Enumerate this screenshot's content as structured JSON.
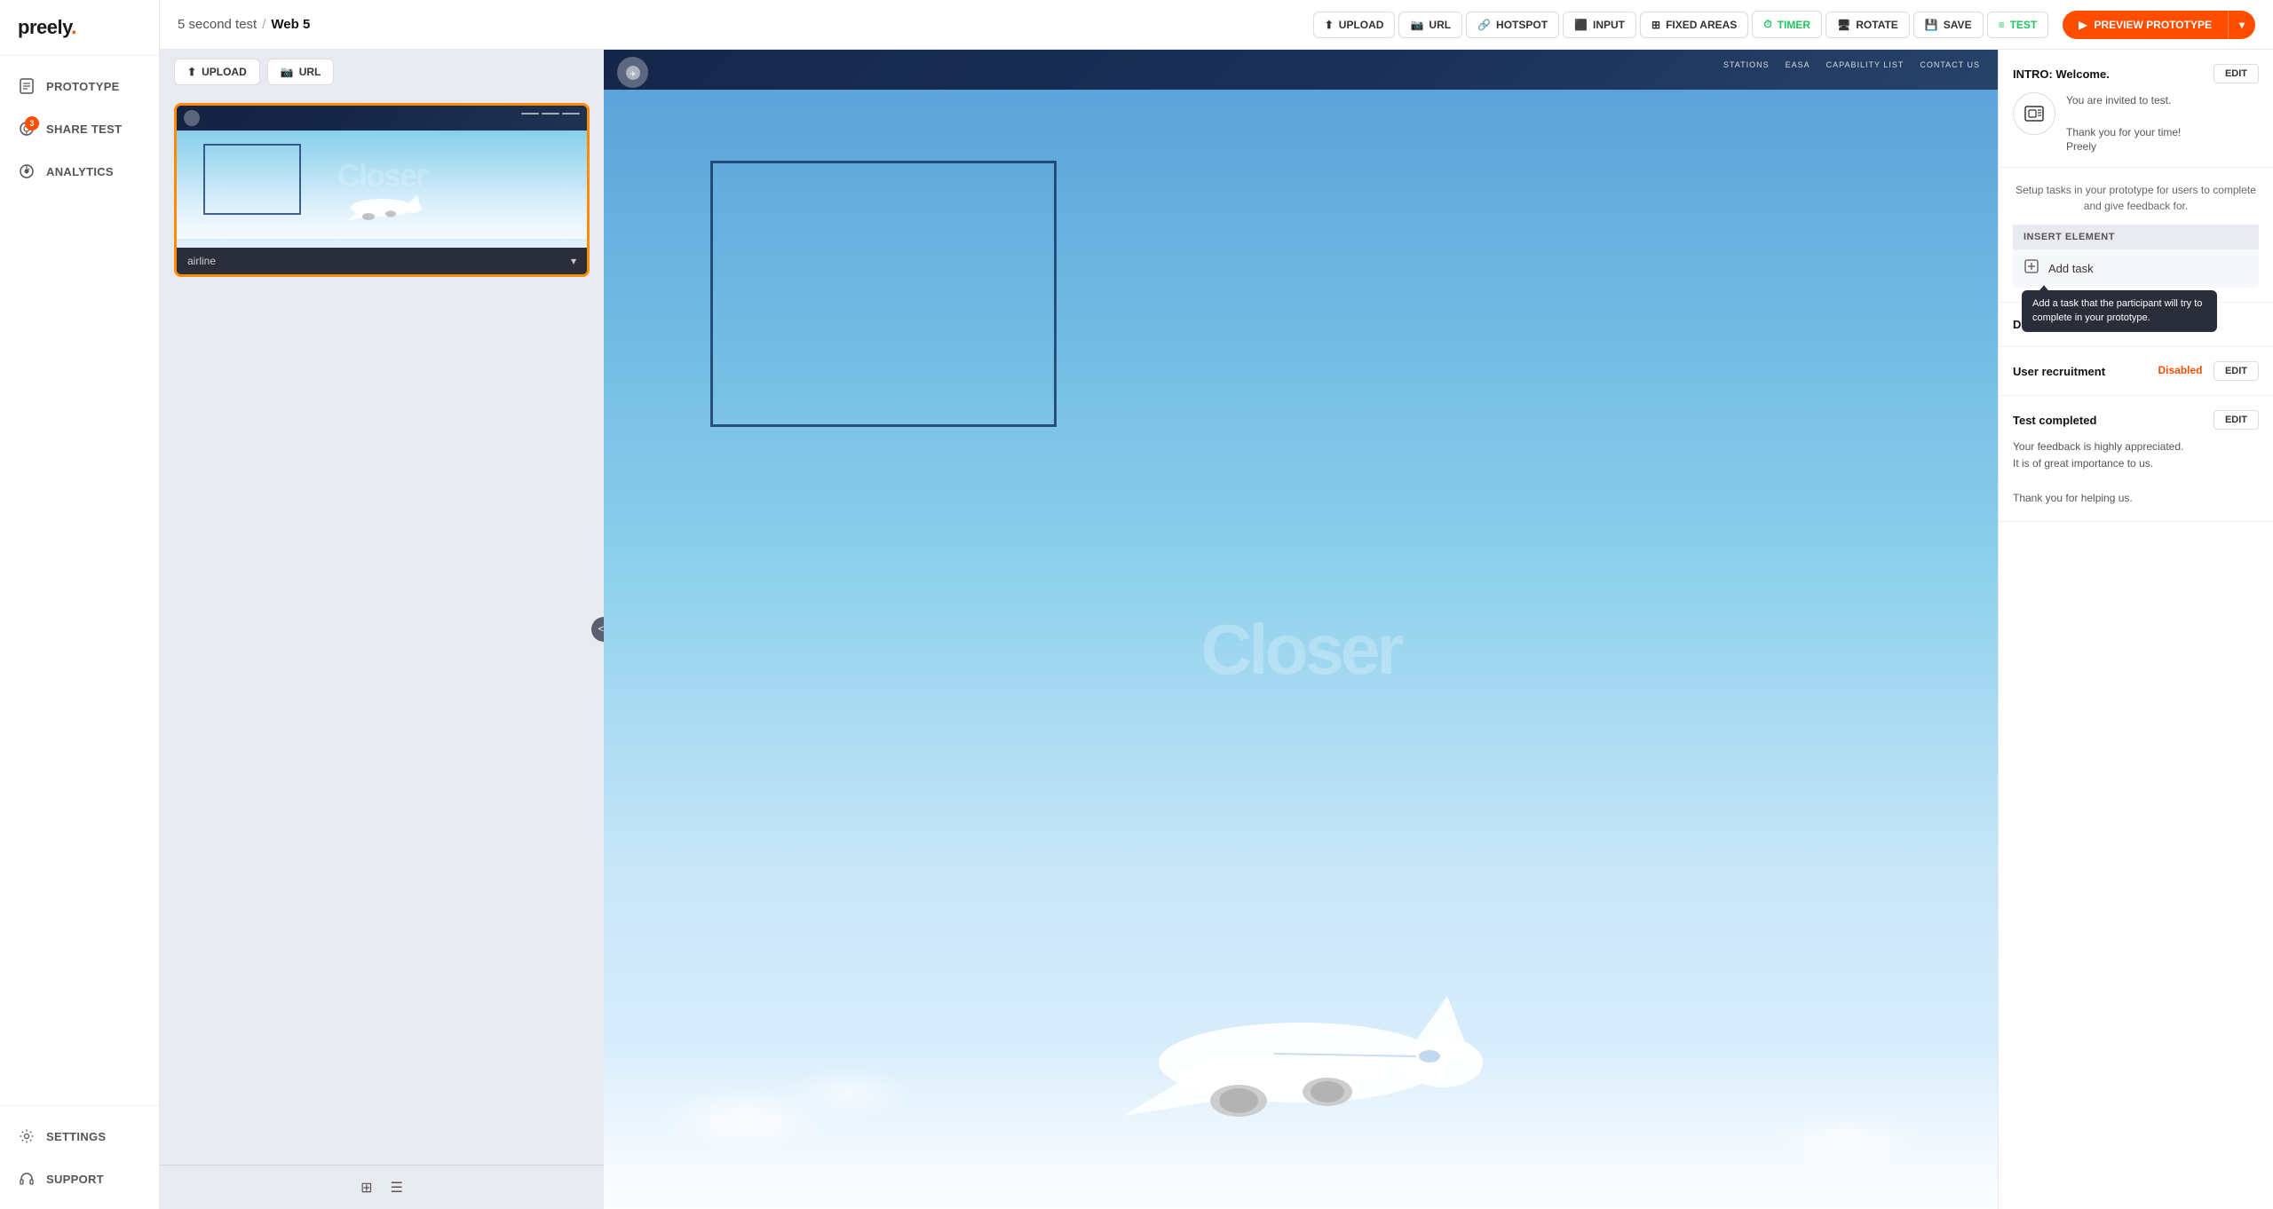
{
  "app": {
    "logo": "preely",
    "logo_dot": "."
  },
  "sidebar": {
    "items": [
      {
        "id": "prototype",
        "label": "PROTOTYPE",
        "icon": "doc-icon",
        "active": false
      },
      {
        "id": "share-test",
        "label": "SHARE TEST",
        "icon": "share-icon",
        "active": false,
        "badge": "3"
      },
      {
        "id": "analytics",
        "label": "ANALYTICS",
        "icon": "analytics-icon",
        "active": false
      }
    ],
    "bottom_items": [
      {
        "id": "settings",
        "label": "SETTINGS",
        "icon": "gear-icon"
      },
      {
        "id": "support",
        "label": "SUPPORT",
        "icon": "headphone-icon"
      }
    ]
  },
  "header": {
    "breadcrumb_project": "5 second test",
    "breadcrumb_separator": "/",
    "breadcrumb_screen": "Web 5",
    "tools": [
      {
        "id": "upload",
        "label": "UPLOAD",
        "icon": "upload-icon"
      },
      {
        "id": "url",
        "label": "URL",
        "icon": "camera-icon"
      },
      {
        "id": "hotspot",
        "label": "HOTSPOT",
        "icon": "link-icon"
      },
      {
        "id": "input",
        "label": "INPUT",
        "icon": "input-icon"
      },
      {
        "id": "fixed-areas",
        "label": "FIXED AREAS",
        "icon": "grid-icon"
      },
      {
        "id": "timer",
        "label": "TIMER",
        "icon": "timer-icon"
      },
      {
        "id": "rotate",
        "label": "ROTATE",
        "icon": "rotate-icon"
      },
      {
        "id": "save",
        "label": "SAVE",
        "icon": "save-icon"
      },
      {
        "id": "test",
        "label": "TEST",
        "icon": "list-icon"
      }
    ],
    "preview_button": "PREVIEW PROTOTYPE"
  },
  "screen_thumbnail": {
    "label": "airline",
    "nav_items": [
      "STATIONS",
      "EASA",
      "CAPABILITY LIST",
      "CONTACT US"
    ]
  },
  "right_panel": {
    "intro_section": {
      "title": "INTRO: Welcome.",
      "edit_label": "EDIT",
      "invited_text": "You are invited to test.",
      "thank_text": "Thank you for your time!",
      "brand": "Preely"
    },
    "tasks_section": {
      "setup_text": "Setup tasks in your prototype for users to complete and give feedback for.",
      "insert_element_header": "INSERT ELEMENT",
      "add_task_label": "Add task",
      "tooltip_text": "Add a task that the participant will try to complete in your prototype."
    },
    "demographics_section": {
      "title": "Demogra...",
      "label": "Demographics"
    },
    "recruitment_section": {
      "title": "User recruitment",
      "status": "Disabled",
      "edit_label": "EDIT"
    },
    "completed_section": {
      "title": "Test completed",
      "edit_label": "EDIT",
      "line1": "Your feedback is highly appreciated.",
      "line2": "It is of great importance to us.",
      "line3": "Thank you for helping us."
    }
  },
  "colors": {
    "accent": "#ff4d00",
    "active_border": "#ff8c00",
    "sidebar_bg": "#ffffff",
    "panel_bg": "#f5f7fa",
    "dark_bg": "#2a2e3a",
    "timer_green": "#22c55e",
    "test_green": "#22c55e"
  }
}
